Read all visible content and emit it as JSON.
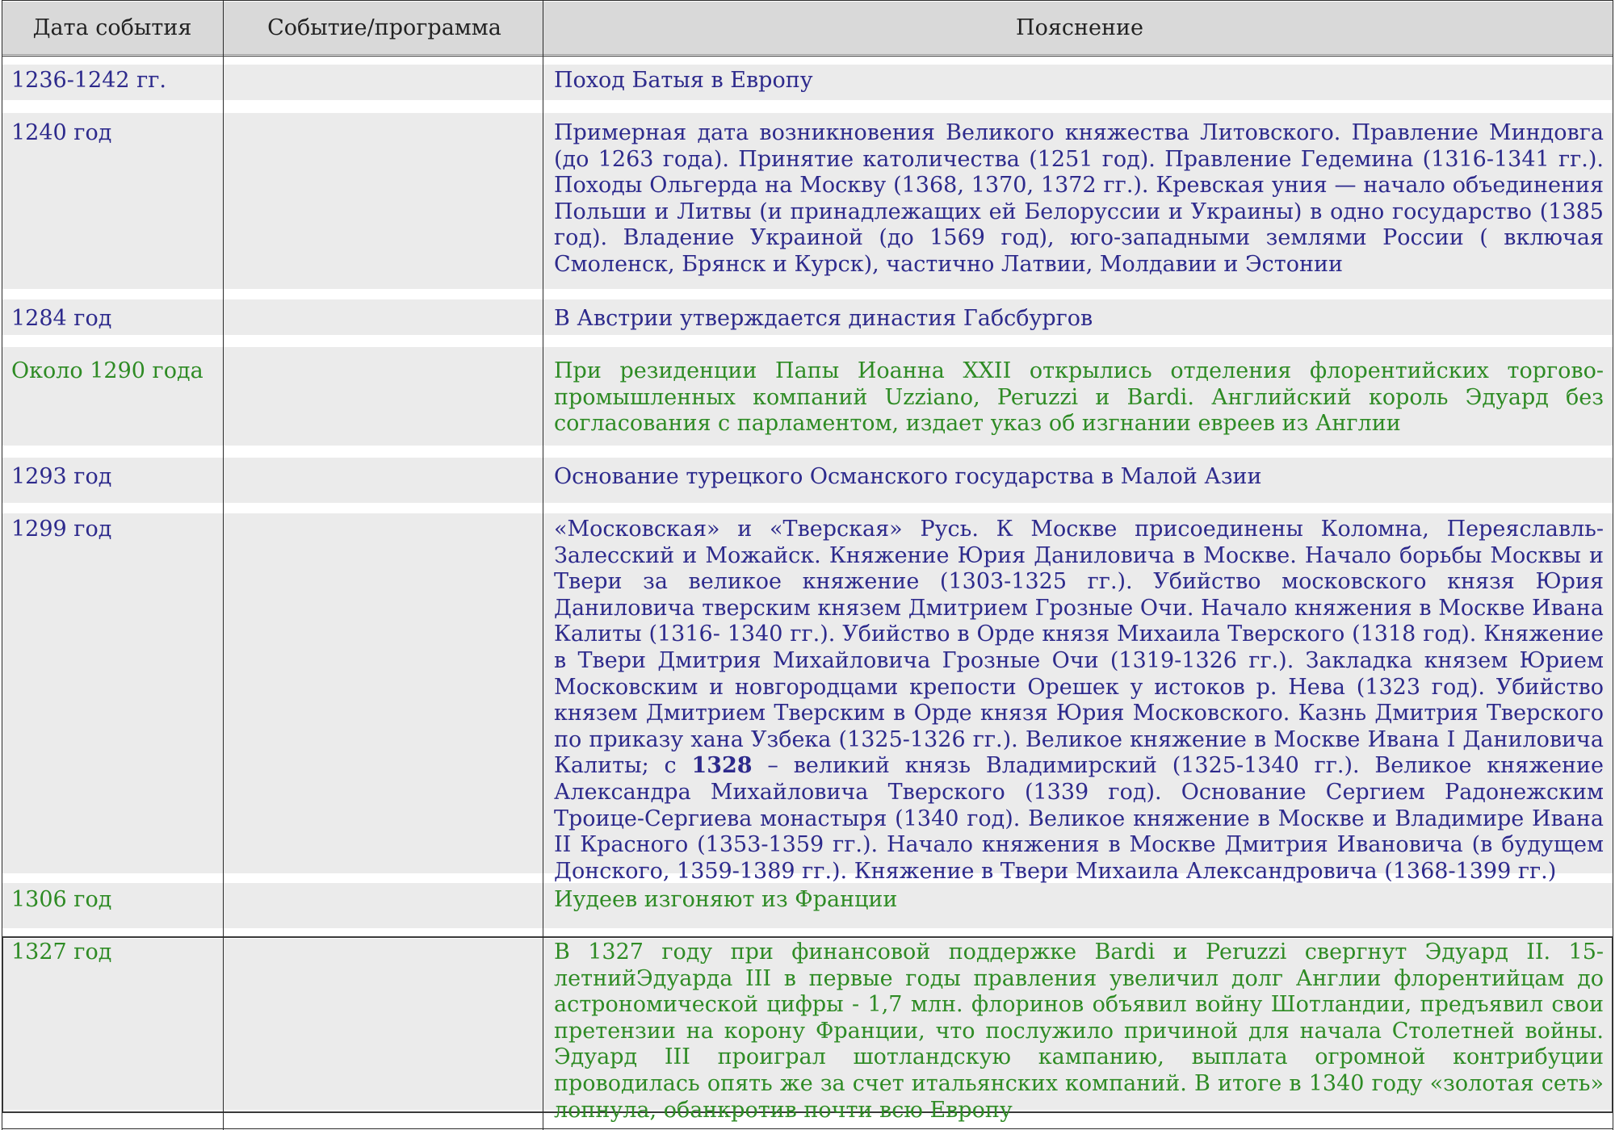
{
  "table": {
    "headers": {
      "date": "Дата события",
      "event": "Событие/программа",
      "explanation": "Пояснение"
    },
    "rows": [
      {
        "date": "1236-1242 гг.",
        "text": "Поход Батыя в  Европу",
        "color": "#2d2a8c"
      },
      {
        "date": "1240 год",
        "text": "Примерная дата возникновения Великого княжества Литовского. Правление Миндовга (до 1263 года). Принятие католичества (1251 год). Правление Гедемина (1316-1341 гг.).  Походы Ольгерда на Москву (1368, 1370, 1372 гг.). Кревская уния — начало объединения Польши и Литвы (и принадлежащих ей Белоруссии и Украины) в одно государство (1385 год). Владение Украиной (до 1569 год), юго-западными землями России ( включая Смоленск, Брянск и Курск), частично Латвии, Молдавии и Эстонии",
        "color": "#2d2a8c"
      },
      {
        "date": "1284 год",
        "text": "В Австрии утверждается династия Габсбургов",
        "color": "#2d2a8c"
      },
      {
        "date": "Около 1290 года",
        "text": "При резиденции Папы Иоанна XXII открылись отделения флорентийских торгово-промышленных компаний Uzziano, Peruzzi и Bardi. Английский король Эдуард без согласования с парламентом, издает указ об изгнании евреев из Англии",
        "color": "#2e8b24"
      },
      {
        "date": "1293 год",
        "text": "Основание турецкого Османского государства в Малой Азии",
        "color": "#2d2a8c"
      },
      {
        "date": "1299 год",
        "text_before": "«Московская» и «Тверская» Русь. К Москве присоединены Коломна, Переяславль-Залесский и Можайск. Княжение Юрия Даниловича в Москве. Начало борьбы Москвы и Твери за великое княжение (1303-1325 гг.). Убийство московского князя Юрия Даниловича тверским князем Дмитрием Грозные Очи. Начало княжения в Москве Ивана Калиты (1316- 1340 гг.). Убийство в Орде князя Михаила Тверского (1318 год). Княжение в Твери Дмитрия Михайловича Грозные Очи (1319-1326 гг.). Закладка князем Юрием Московским и новгородцами крепости Орешек у истоков р. Нева (1323 год). Убийство князем Дмитрием Тверским в Орде князя Юрия Московского. Казнь Дмитрия Тверского по приказу хана Узбека (1325-1326 гг.). Великое княжение в Москве Ивана I Даниловича Калиты; с ",
        "text_bold": "1328",
        "text_after": " –  великий князь Владимирский (1325-1340 гг.). Великое княжение Александра Михайловича Тверского (1339 год). Основание Сергием Радонежским Троице-Сергиева монастыря (1340 год). Великое княжение в Москве и Владимире Ивана II Красного (1353-1359 гг.). Начало княжения в Москве Дмитрия Ивановича (в будущем Донского, 1359-1389 гг.). Княжение в Твери Михаила Александровича (1368-1399 гг.)",
        "color": "#2d2a8c"
      },
      {
        "date": "1306 год",
        "text": "Иудеев изгоняют из Франции",
        "color": "#2e8b24"
      },
      {
        "date": "1327 год",
        "text": "В 1327 году при финансовой поддержке Bardi и Peruzzi свергнут Эдуард II. 15-летнийЭдуарда III в первые годы правления увеличил долг Англии флорентийцам до астрономической цифры - 1,7 млн. флоринов объявил войну Шотландии, предъявил свои претензии на корону Франции, что послужило причиной для начала Столетней войны. Эдуард III проиграл шотландскую кампанию, выплата огромной контрибуции проводилась опять же за счет итальянских компаний. В итоге в 1340 году «золотая сеть» лопнула, обанкротив почти всю Европу",
        "color": "#2e8b24"
      }
    ]
  }
}
